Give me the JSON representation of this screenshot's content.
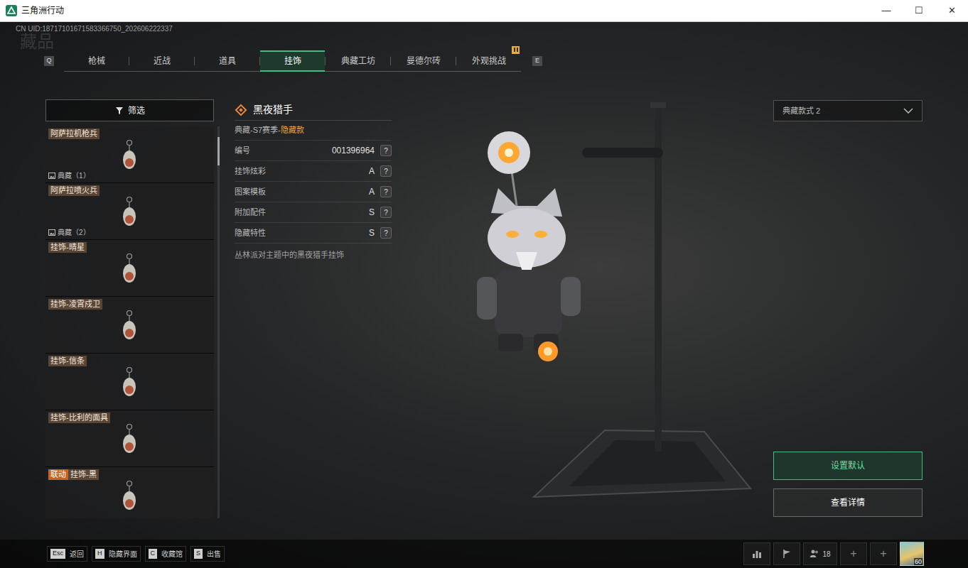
{
  "window": {
    "title": "三角洲行动",
    "controls": [
      "—",
      "☐",
      "✕"
    ]
  },
  "uid": "CN UID:18717101671583366750_202606222337",
  "page_title": "藏品",
  "tabs": {
    "prev_key": "Q",
    "next_key": "E",
    "items": [
      {
        "label": "枪械",
        "selected": false,
        "badge": false
      },
      {
        "label": "近战",
        "selected": false,
        "badge": false
      },
      {
        "label": "道具",
        "selected": false,
        "badge": false
      },
      {
        "label": "挂饰",
        "selected": true,
        "badge": false
      },
      {
        "label": "典藏工坊",
        "selected": false,
        "badge": false
      },
      {
        "label": "曼德尔砖",
        "selected": false,
        "badge": false
      },
      {
        "label": "外观挑战",
        "selected": false,
        "badge": true
      }
    ]
  },
  "filter": {
    "label": "筛选"
  },
  "list": {
    "scroll_position": 0.03,
    "items": [
      {
        "name": "阿萨拉机枪兵",
        "caption": "典藏（1）"
      },
      {
        "name": "阿萨拉喷火兵",
        "caption": "典藏（2）"
      },
      {
        "name": "挂饰-晴星"
      },
      {
        "name": "挂饰-凌霄戍卫"
      },
      {
        "name": "挂饰-信条"
      },
      {
        "name": "挂饰-比利的面具"
      },
      {
        "name": "挂饰-黑",
        "tag": "联动",
        "tag_color": "#c8641e"
      }
    ]
  },
  "detail": {
    "name": "黑夜猎手",
    "series": "典藏-S7赛季-",
    "rarity": "隐藏款",
    "rows": [
      {
        "label": "编号",
        "value": "001396964",
        "help": "?"
      },
      {
        "label": "挂饰炫彩",
        "value": "A",
        "help": "?"
      },
      {
        "label": "图案模板",
        "value": "A",
        "help": "?"
      },
      {
        "label": "附加配件",
        "value": "S",
        "help": "?"
      },
      {
        "label": "隐藏特性",
        "value": "S",
        "help": "?"
      }
    ],
    "description": "丛林派对主题中的黑夜猎手挂饰"
  },
  "variant_select": {
    "value": "典藏款式 2"
  },
  "actions": [
    {
      "label": "设置默认",
      "primary": true
    },
    {
      "label": "查看详情",
      "primary": false
    }
  ],
  "hotkeys": [
    {
      "key": "Esc",
      "label": "返回"
    },
    {
      "key": "H",
      "label": "隐藏界面"
    },
    {
      "key": "C",
      "label": "收藏馆"
    },
    {
      "key": "S",
      "label": "出售"
    }
  ],
  "status": {
    "friends": "18",
    "plus_buttons": [
      "+",
      "+"
    ],
    "level": "60"
  }
}
